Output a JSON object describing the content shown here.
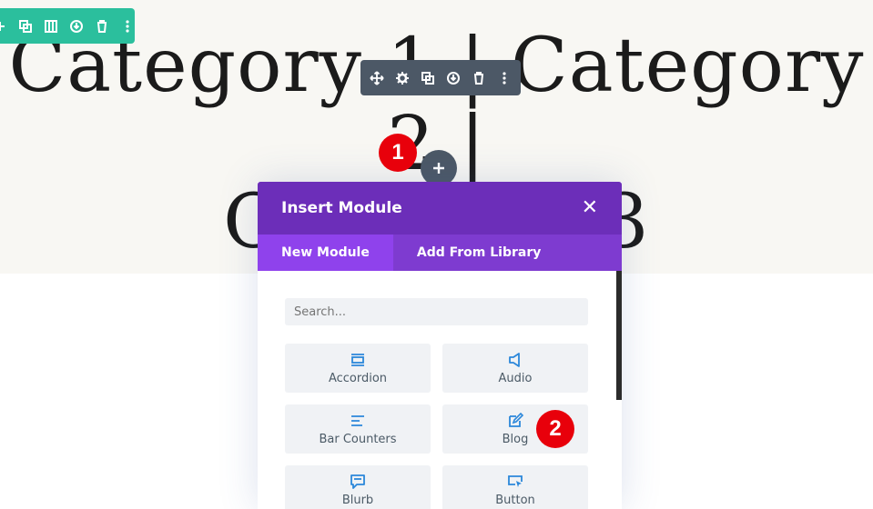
{
  "page": {
    "heading_line1": "Category 1 | Category 2 |",
    "heading_line2": "Category 3"
  },
  "section_toolbar": {
    "icons": [
      "add-icon",
      "duplicate-icon",
      "columns-icon",
      "save-icon",
      "delete-icon",
      "more-icon"
    ]
  },
  "module_toolbar": {
    "icons": [
      "move-icon",
      "settings-icon",
      "duplicate-icon",
      "save-icon",
      "delete-icon",
      "more-icon"
    ]
  },
  "annotations": {
    "step1": "1",
    "step2": "2"
  },
  "add_button": {
    "label": "+"
  },
  "modal": {
    "title": "Insert Module",
    "close_label": "✕",
    "tabs": [
      {
        "label": "New Module"
      },
      {
        "label": "Add From Library"
      }
    ],
    "search_placeholder": "Search...",
    "modules": [
      {
        "label": "Accordion",
        "icon": "accordion-icon"
      },
      {
        "label": "Audio",
        "icon": "audio-icon"
      },
      {
        "label": "Bar Counters",
        "icon": "bar-counters-icon"
      },
      {
        "label": "Blog",
        "icon": "blog-icon"
      },
      {
        "label": "Blurb",
        "icon": "blurb-icon"
      },
      {
        "label": "Button",
        "icon": "button-icon"
      }
    ]
  },
  "colors": {
    "section_toolbar": "#2bbf9d",
    "module_toolbar": "#4c5866",
    "modal_header": "#6c2eb9",
    "modal_tabs": "#7e3bd0",
    "icon_blue": "#2b87da",
    "badge_red": "#e8000b"
  }
}
